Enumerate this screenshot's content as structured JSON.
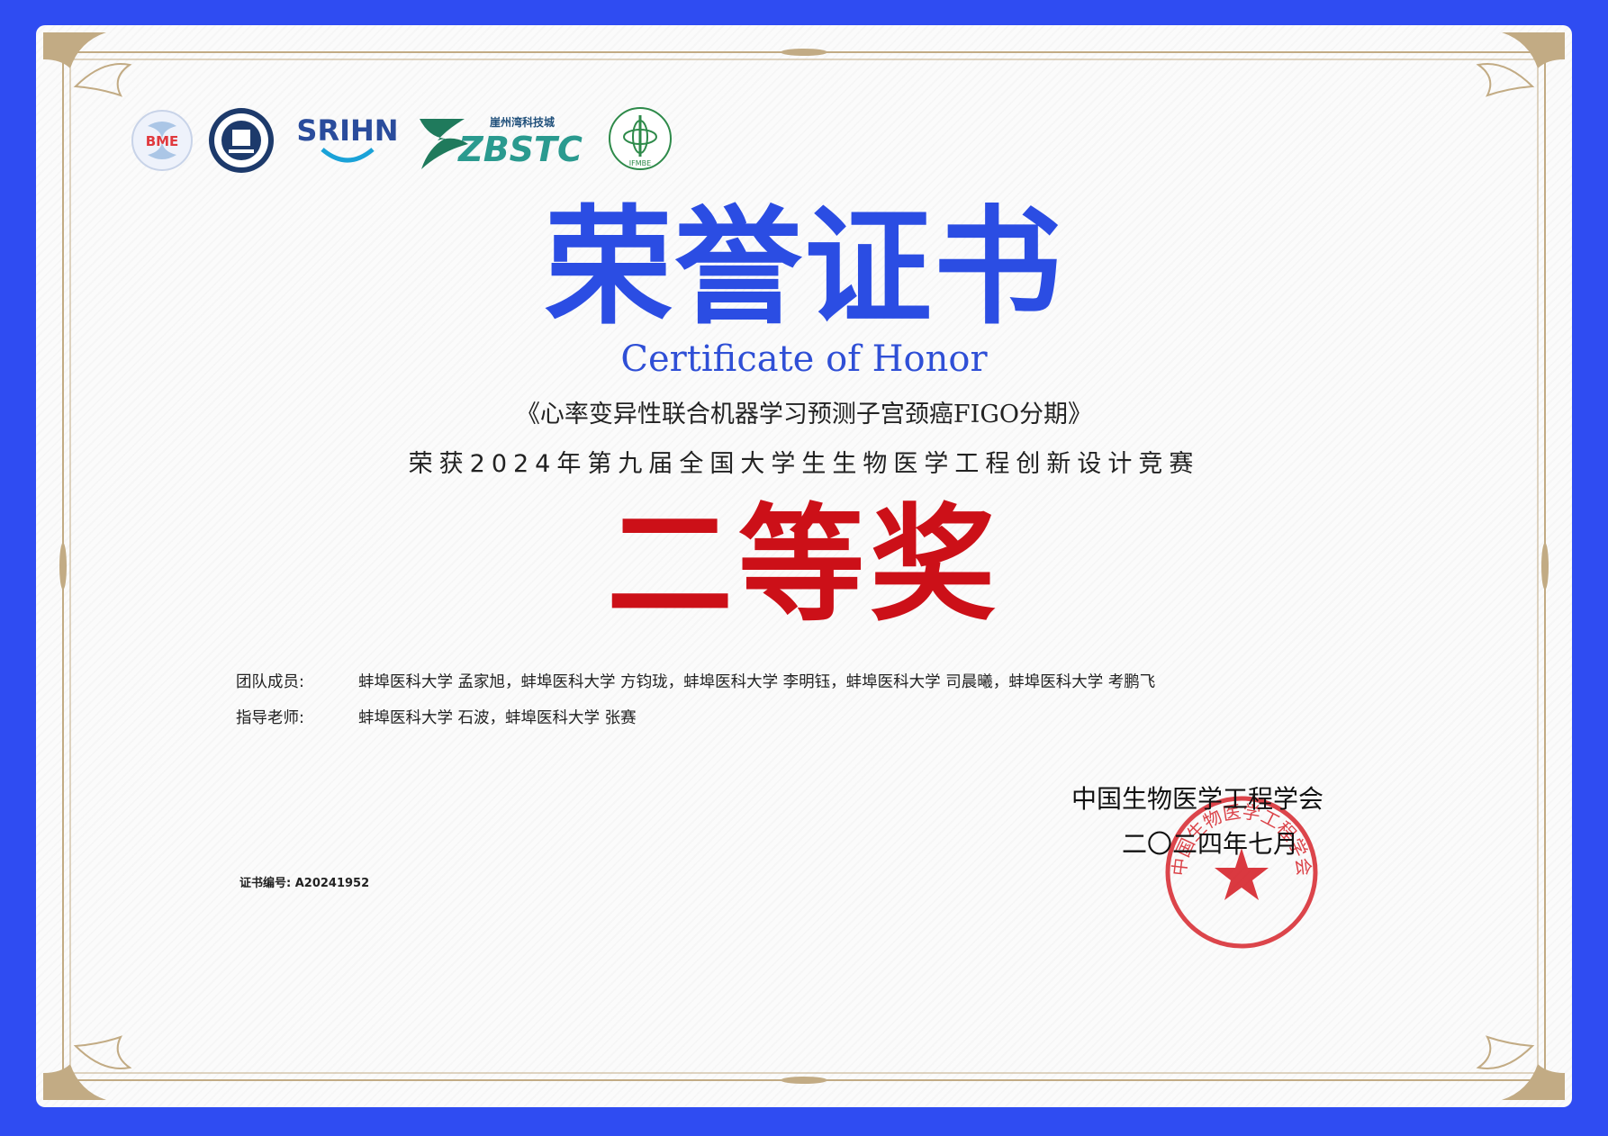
{
  "logos": {
    "bme": "BME",
    "srihn": "SRIHN",
    "zbstc": "ZBSTC",
    "zbstc_cn": "崖州湾科技城",
    "ifmbe": "IFMBE"
  },
  "certificate": {
    "title_cn": "荣誉证书",
    "title_en": "Certificate of Honor",
    "project": "《心率变异性联合机器学习预测子宫颈癌FIGO分期》",
    "award_line": "荣获2024年第九届全国大学生生物医学工程创新设计竞赛",
    "prize": "二等奖"
  },
  "members": {
    "team_label": "团队成员:",
    "team_value": "蚌埠医科大学 孟家旭，蚌埠医科大学 方钧珑，蚌埠医科大学 李明钰，蚌埠医科大学 司晨曦，蚌埠医科大学 考鹏飞",
    "advisor_label": "指导老师:",
    "advisor_value": "蚌埠医科大学 石波，蚌埠医科大学 张赛"
  },
  "issuer": {
    "org": "中国生物医学工程学会",
    "date": "二〇二四年七月",
    "seal_text": "中国生物医学工程学会"
  },
  "cert_no": "证书编号: A20241952",
  "colors": {
    "blue": "#2b4de3",
    "red": "#cc1018",
    "gold": "#c2ab84",
    "background": "#2f4cf2"
  }
}
